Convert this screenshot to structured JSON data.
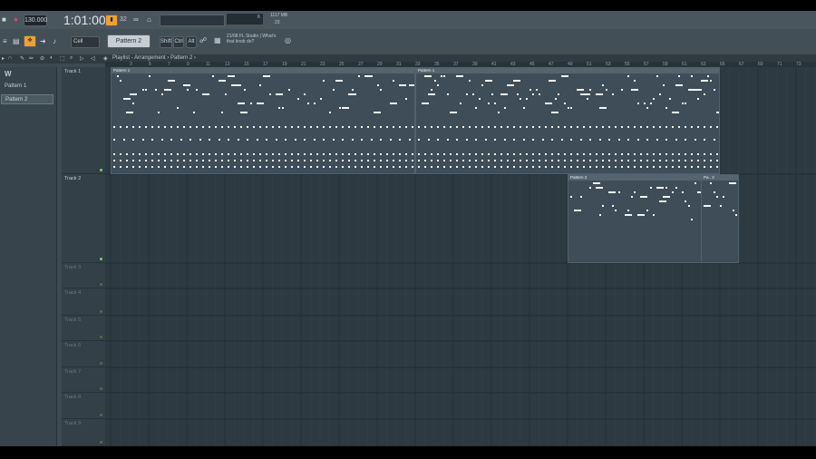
{
  "transport": {
    "tempo": "130.000",
    "time": "1:01:00",
    "pattern_selector": "Pattern 2",
    "snap": "Cell",
    "memory": "1117 MB",
    "cpu": "6",
    "polyphony": "23",
    "hint_date": "21/08",
    "hint_text": "FL Studio | What's that knob do?",
    "mode_shift": "Shift",
    "mode_ctrl": "Ctrl",
    "mode_alt": "Alt",
    "beat_label": "32"
  },
  "playlist": {
    "breadcrumb": "Playlist - Arrangement › Pattern 2 ›",
    "patterns": [
      "Pattern 1",
      "Pattern 2"
    ],
    "ruler": [
      "3",
      "5",
      "7",
      "9",
      "11",
      "13",
      "15",
      "17",
      "19",
      "21",
      "23",
      "25",
      "27",
      "29",
      "31",
      "33",
      "35",
      "37",
      "39",
      "41",
      "43",
      "45",
      "47",
      "49",
      "51",
      "53",
      "55",
      "57",
      "59",
      "61",
      "63",
      "65",
      "67",
      "69",
      "71",
      "73"
    ],
    "tracks": [
      {
        "name": "Track 1",
        "active": true
      },
      {
        "name": "Track 2",
        "active": true
      },
      {
        "name": "Track 3",
        "active": false
      },
      {
        "name": "Track 4",
        "active": false
      },
      {
        "name": "Track 5",
        "active": false
      },
      {
        "name": "Track 6",
        "active": false
      },
      {
        "name": "Track 7",
        "active": false
      },
      {
        "name": "Track 8",
        "active": false
      },
      {
        "name": "Track 9",
        "active": false
      }
    ],
    "clips": [
      {
        "label": "Pattern 1",
        "track": 0,
        "start": 0,
        "length": 32
      },
      {
        "label": "Pattern 1",
        "track": 0,
        "start": 32,
        "length": 32
      },
      {
        "label": "Pattern 2",
        "track": 1,
        "start": 48,
        "length": 16
      },
      {
        "label": "Pa.. 2",
        "track": 1,
        "start": 62,
        "length": 4
      }
    ]
  },
  "colors": {
    "accent": "#f0a030",
    "note": "#f2f5f7",
    "track_dot": "#7bd35a"
  }
}
